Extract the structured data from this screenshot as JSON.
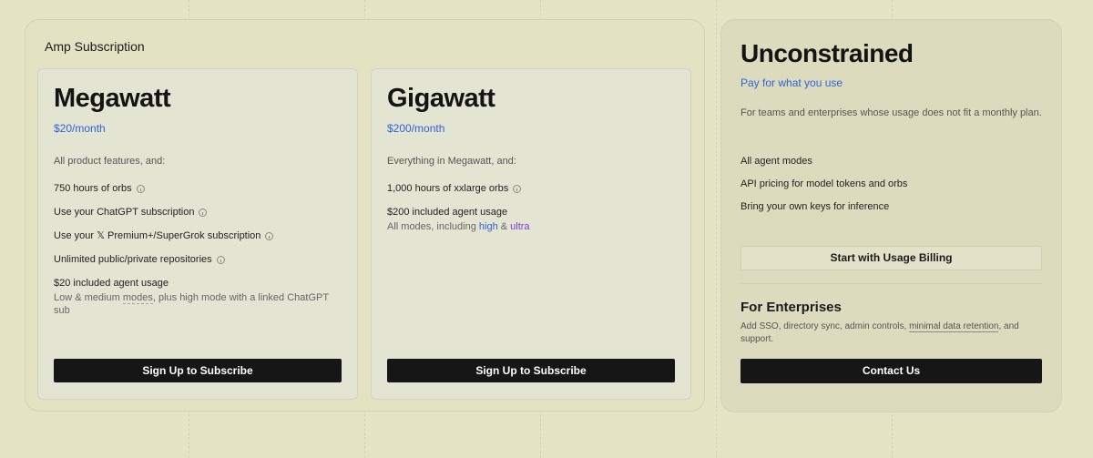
{
  "subscription": {
    "title": "Amp Subscription",
    "plans": [
      {
        "name": "Megawatt",
        "price": "$20/month",
        "intro": "All product features, and:",
        "features": [
          "750 hours of orbs",
          "Use your ChatGPT subscription",
          "Use your 𝕏 Premium+/SuperGrok subscription",
          "Unlimited public/private repositories"
        ],
        "usage": {
          "title": "$20 included agent usage",
          "detail_prefix": "Low & medium ",
          "detail_link": "modes",
          "detail_suffix": ", plus high mode with a linked ChatGPT sub"
        },
        "button": "Sign Up to Subscribe"
      },
      {
        "name": "Gigawatt",
        "price": "$200/month",
        "intro": "Everything in Megawatt, and:",
        "features": [
          "1,000 hours of xxlarge orbs"
        ],
        "usage": {
          "title": "$200 included agent usage",
          "detail_prefix": "All modes, including ",
          "detail_high": "high",
          "detail_amp": " & ",
          "detail_ultra": "ultra"
        },
        "button": "Sign Up to Subscribe"
      }
    ]
  },
  "unconstrained": {
    "title": "Unconstrained",
    "subtitle": "Pay for what you use",
    "description": "For teams and enterprises whose usage does not fit a monthly plan.",
    "features": [
      "All agent modes",
      "API pricing for model tokens and orbs",
      "Bring your own keys for inference"
    ],
    "usage_button": "Start with Usage Billing",
    "enterprise": {
      "title": "For Enterprises",
      "desc_prefix": "Add SSO, directory sync, admin controls, ",
      "desc_link": "minimal data retention",
      "desc_suffix": ", and support.",
      "button": "Contact Us"
    }
  },
  "colors": {
    "background": "#e5e4c4",
    "accent_blue": "#2f63d8",
    "accent_purple": "#7a3ed4",
    "button_dark": "#161616"
  }
}
